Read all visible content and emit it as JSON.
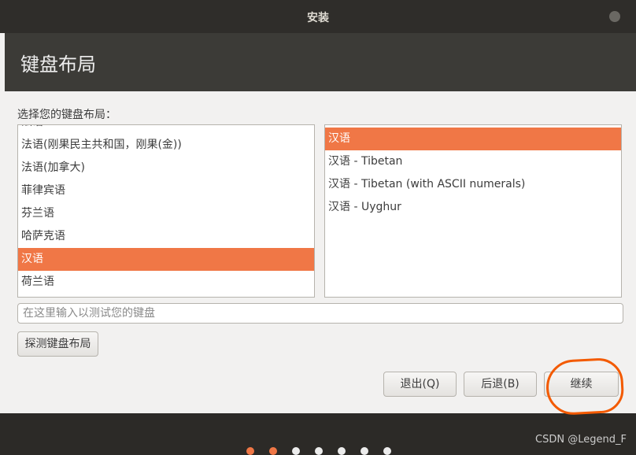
{
  "window": {
    "title": "安装",
    "close_icon": "close-icon"
  },
  "header": {
    "title": "键盘布局"
  },
  "prompt": "选择您的键盘布局：",
  "layouts": {
    "partial_top": "法语",
    "items": [
      {
        "label": "法语(刚果民主共和国，刚果(金))",
        "selected": false
      },
      {
        "label": "法语(加拿大)",
        "selected": false
      },
      {
        "label": "菲律宾语",
        "selected": false
      },
      {
        "label": "芬兰语",
        "selected": false
      },
      {
        "label": "哈萨克语",
        "selected": false
      },
      {
        "label": "汉语",
        "selected": true
      },
      {
        "label": "荷兰语",
        "selected": false
      }
    ]
  },
  "variants": {
    "items": [
      {
        "label": "汉语",
        "selected": true
      },
      {
        "label": "汉语 - Tibetan",
        "selected": false
      },
      {
        "label": "汉语 - Tibetan (with ASCII numerals)",
        "selected": false
      },
      {
        "label": "汉语 - Uyghur",
        "selected": false
      }
    ]
  },
  "test_input": {
    "placeholder": "在这里输入以测试您的键盘"
  },
  "buttons": {
    "detect": "探测键盘布局",
    "quit": "退出(Q)",
    "back": "后退(B)",
    "continue": "继续"
  },
  "progress": {
    "total_steps": 7,
    "completed_steps": 2
  },
  "watermark": "CSDN @Legend_F",
  "colors": {
    "accent": "#f07746",
    "annotation": "#f35a00",
    "header_bg": "#3c3b37"
  }
}
